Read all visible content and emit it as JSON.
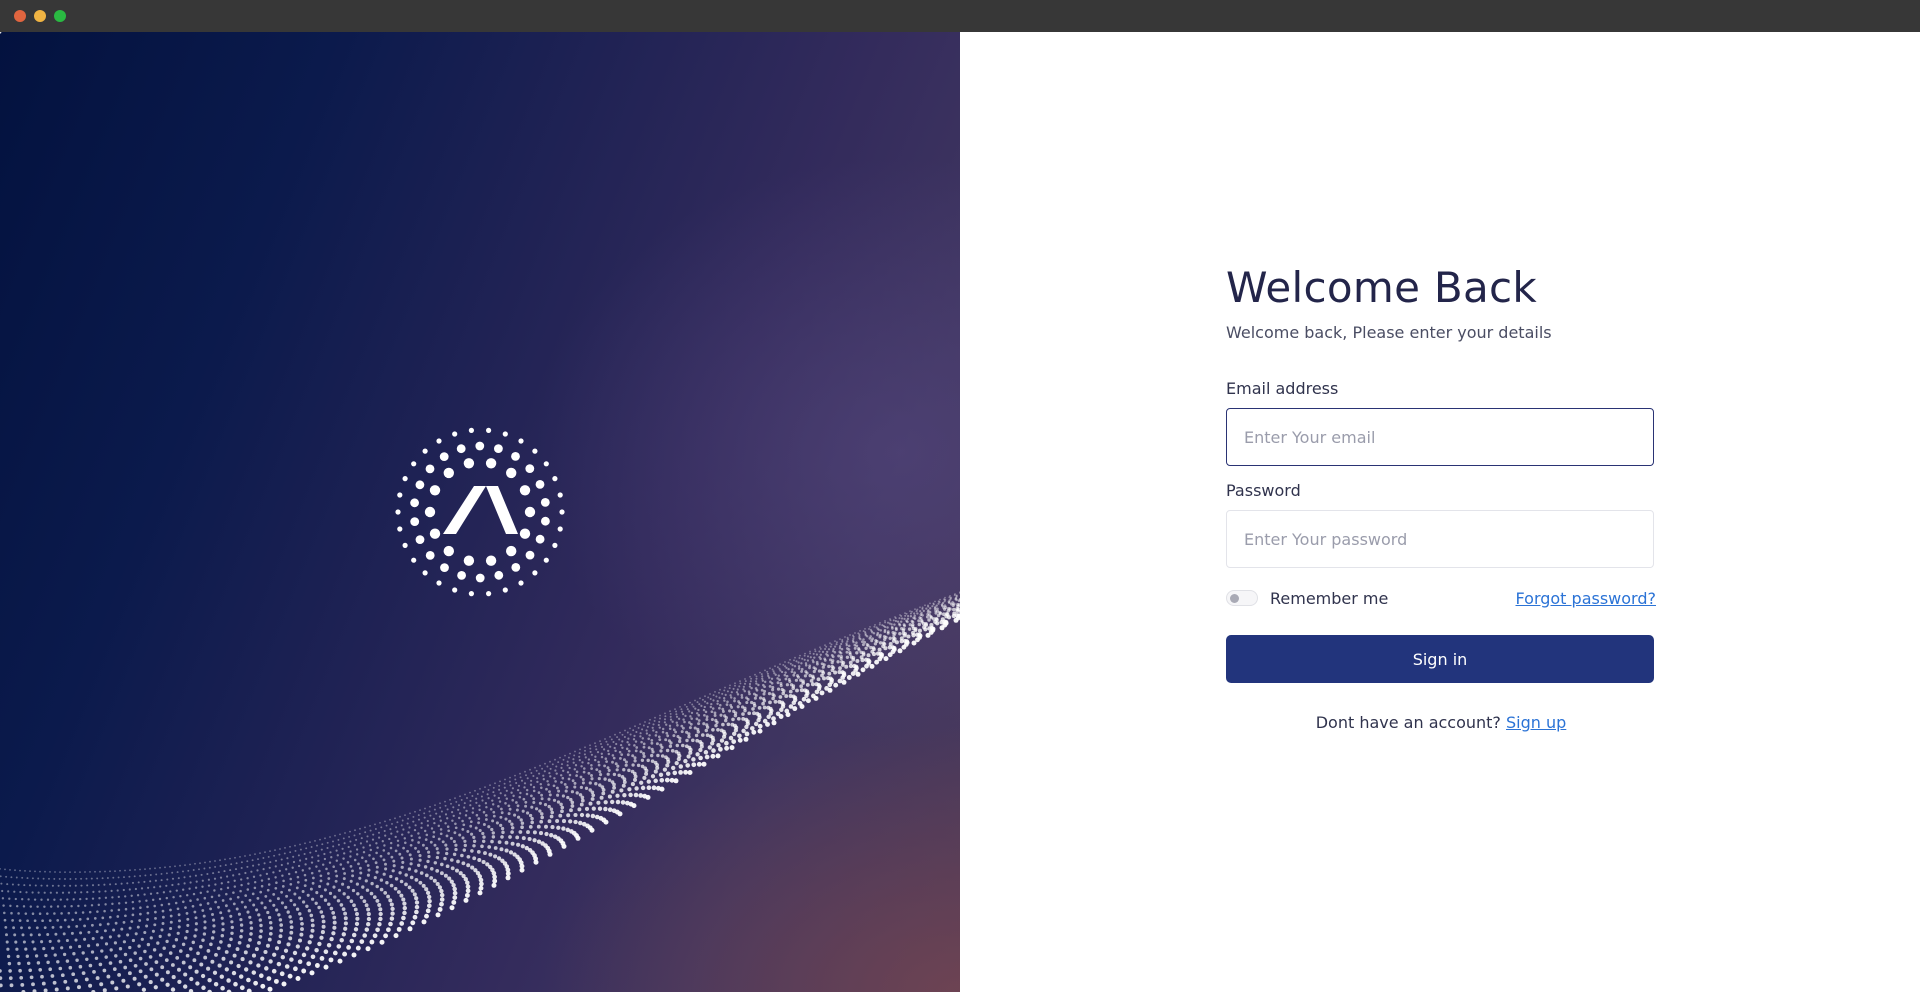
{
  "window": {
    "controls": [
      "close",
      "minimize",
      "maximize"
    ]
  },
  "hero": {
    "logo_icon": "sunburst-logo-icon",
    "background_colors": [
      "#03123f",
      "#332b5c",
      "#4b3a5a"
    ]
  },
  "login": {
    "title": "Welcome Back",
    "subtitle": "Welcome back, Please enter your details",
    "email_label": "Email address",
    "email_placeholder": "Enter Your email",
    "email_value": "",
    "password_label": "Password",
    "password_placeholder": "Enter Your password",
    "password_value": "",
    "remember_label": "Remember me",
    "remember_checked": false,
    "forgot_label": "Forgot password?",
    "signin_label": "Sign in",
    "signup_prompt": "Dont have an account?",
    "signup_label": "Sign up"
  },
  "colors": {
    "primary_button": "#22347c",
    "link": "#2b73d6",
    "heading": "#23254a"
  }
}
